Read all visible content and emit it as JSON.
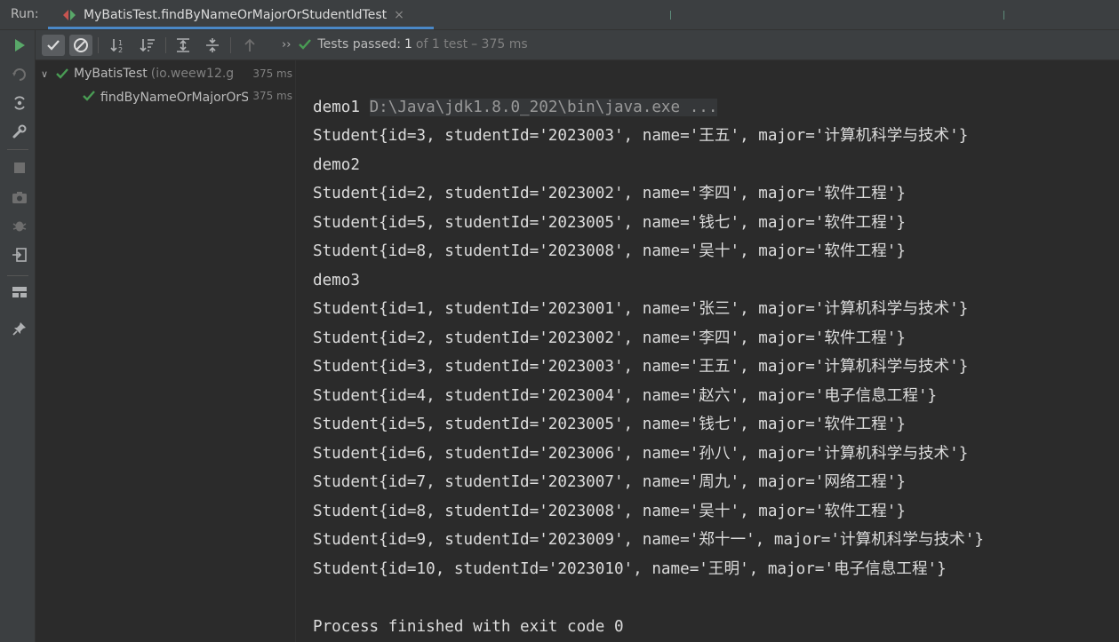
{
  "header": {
    "run_label": "Run:",
    "tab_title": "MyBatisTest.findByNameOrMajorOrStudentIdTest",
    "tab_close": "×"
  },
  "toolbar": {
    "chevron": "››",
    "status_passed": "Tests passed:",
    "status_count": "1",
    "status_total": "of 1 test",
    "status_duration": "– 375 ms"
  },
  "tree": {
    "root": {
      "arrow": "∨",
      "name": "MyBatisTest",
      "package": "(io.weew12.g",
      "time": "375 ms"
    },
    "child": {
      "name": "findByNameOrMajorOrStudentIdTest",
      "time": "375 ms"
    }
  },
  "console": {
    "command": "D:\\Java\\jdk1.8.0_202\\bin\\java.exe ...",
    "lines": [
      "demo1",
      "Student{id=3, studentId='2023003', name='王五', major='计算机科学与技术'}",
      "demo2",
      "Student{id=2, studentId='2023002', name='李四', major='软件工程'}",
      "Student{id=5, studentId='2023005', name='钱七', major='软件工程'}",
      "Student{id=8, studentId='2023008', name='吴十', major='软件工程'}",
      "demo3",
      "Student{id=1, studentId='2023001', name='张三', major='计算机科学与技术'}",
      "Student{id=2, studentId='2023002', name='李四', major='软件工程'}",
      "Student{id=3, studentId='2023003', name='王五', major='计算机科学与技术'}",
      "Student{id=4, studentId='2023004', name='赵六', major='电子信息工程'}",
      "Student{id=5, studentId='2023005', name='钱七', major='软件工程'}",
      "Student{id=6, studentId='2023006', name='孙八', major='计算机科学与技术'}",
      "Student{id=7, studentId='2023007', name='周九', major='网络工程'}",
      "Student{id=8, studentId='2023008', name='吴十', major='软件工程'}",
      "Student{id=9, studentId='2023009', name='郑十一', major='计算机科学与技术'}",
      "Student{id=10, studentId='2023010', name='王明', major='电子信息工程'}",
      "",
      "Process finished with exit code 0"
    ]
  },
  "colors": {
    "accent": "#4a88c7",
    "success": "#499c54",
    "rerun": "#59a869"
  }
}
